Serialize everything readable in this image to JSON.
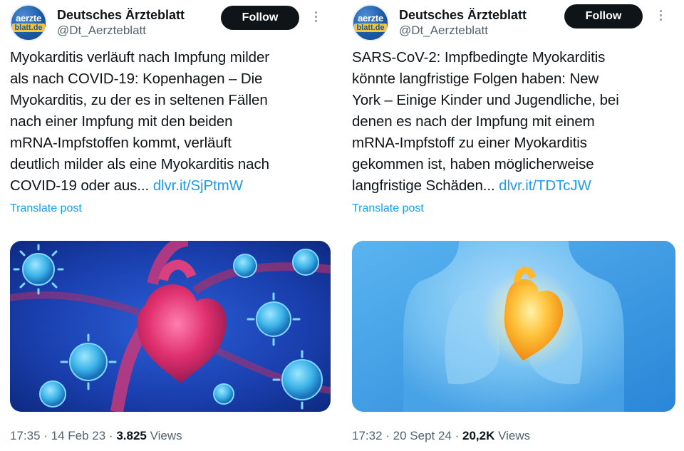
{
  "posts": [
    {
      "avatar": {
        "line1": "aerzte",
        "line2": "blatt.de"
      },
      "display_name": "Deutsches Ärzteblatt",
      "handle": "@Dt_Aerzteblatt",
      "follow_label": "Follow",
      "text_lines": [
        "Myokarditis verläuft nach Impfung milder",
        "als nach COVID-19:  Kopenhagen – Die",
        "Myokarditis, zu der es in seltenen Fällen",
        "nach einer Impfung mit den beiden",
        "mRNA-Impfstoffen kommt, verläuft",
        "deutlich milder als eine Myokarditis nach",
        "COVID-19 oder aus... "
      ],
      "link": "dlvr.it/SjPtmW",
      "translate_label": "Translate post",
      "time": "17:35 · 14 Feb 23 · ",
      "views_count": "3.825",
      "views_label": " Views",
      "media_icon": "heart-virus-illustration"
    },
    {
      "avatar": {
        "line1": "aerzte",
        "line2": "blatt.de"
      },
      "display_name": "Deutsches Ärzteblatt",
      "handle": "@Dt_Aerzteblatt",
      "follow_label": "Follow",
      "text_lines": [
        "SARS-CoV-2: Impfbedingte Myokarditis",
        "könnte langfristige Folgen haben:  New",
        "York – Einige Kinder und Jugendliche, bei",
        "denen es nach der Impfung mit einem",
        "mRNA-Impfstoff zu einer Myokarditis",
        "gekommen ist, haben möglicherweise",
        "langfristige Schäden... "
      ],
      "link": "dlvr.it/TDTcJW",
      "translate_label": "Translate post",
      "time": "17:32 · 20 Sept 24 · ",
      "views_count": "20,2K",
      "views_label": " Views",
      "media_icon": "torso-heart-illustration"
    }
  ],
  "colors": {
    "link": "#1d9bf0",
    "text": "#0f1419",
    "muted": "#536471",
    "follow_bg": "#0f1419"
  }
}
